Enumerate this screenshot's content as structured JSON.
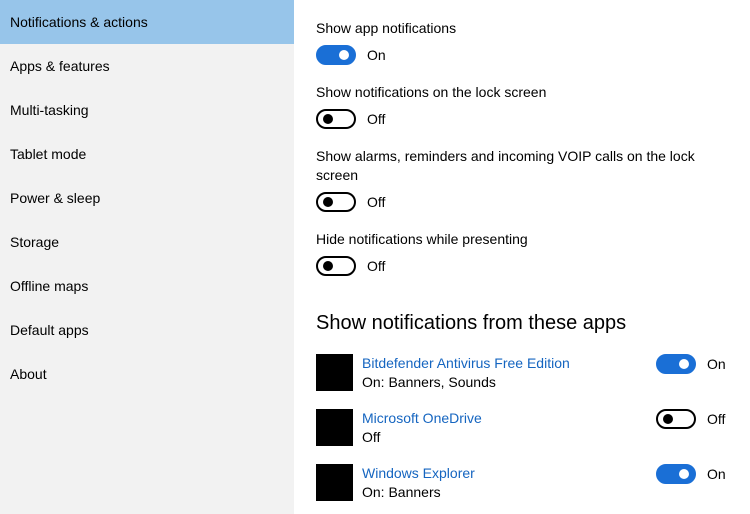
{
  "sidebar": {
    "items": [
      {
        "label": "Notifications & actions",
        "selected": true
      },
      {
        "label": "Apps & features"
      },
      {
        "label": "Multi-tasking"
      },
      {
        "label": "Tablet mode"
      },
      {
        "label": "Power & sleep"
      },
      {
        "label": "Storage"
      },
      {
        "label": "Offline maps"
      },
      {
        "label": "Default apps"
      },
      {
        "label": "About"
      }
    ]
  },
  "settings": [
    {
      "label": "Show app notifications",
      "state": "On"
    },
    {
      "label": "Show notifications on the lock screen",
      "state": "Off"
    },
    {
      "label": "Show alarms, reminders and incoming VOIP calls on the lock screen",
      "state": "Off"
    },
    {
      "label": "Hide notifications while presenting",
      "state": "Off"
    }
  ],
  "apps_section": {
    "heading": "Show notifications from these apps",
    "apps": [
      {
        "name": "Bitdefender Antivirus Free Edition",
        "status": "On: Banners, Sounds",
        "state": "On"
      },
      {
        "name": "Microsoft OneDrive",
        "status": "Off",
        "state": "Off"
      },
      {
        "name": "Windows Explorer",
        "status": "On: Banners",
        "state": "On"
      }
    ]
  },
  "colors": {
    "accent": "#1a6fd6",
    "sidebar_bg": "#f2f2f2",
    "selected_bg": "#97c5ea",
    "link": "#1565c0"
  }
}
